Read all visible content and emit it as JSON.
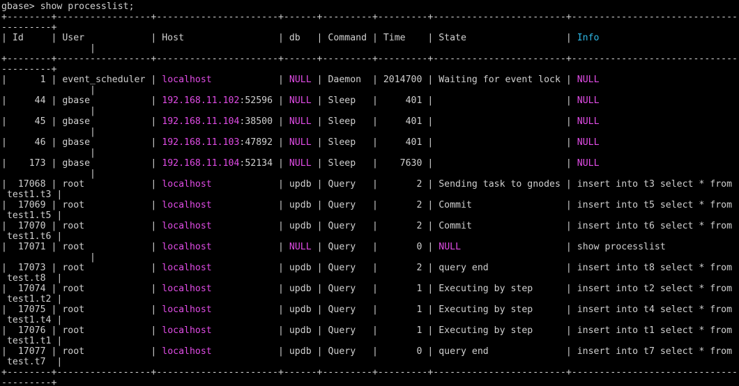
{
  "colors": {
    "background": "#000000",
    "text": "#d0d0d0",
    "null_and_host": "#e14ce6",
    "info_header": "#2fb8e6"
  },
  "terminal": {
    "lines": [
      [
        {
          "t": "gbase> show processlist;",
          "c": "default"
        }
      ],
      [
        {
          "t": "+--------+-----------------+----------------------+------+---------+---------+------------------------+------------------------------------------",
          "c": "default"
        }
      ],
      [
        {
          "t": "---------+",
          "c": "default"
        }
      ],
      [
        {
          "t": "| Id     | User            | Host                 | db   | Command | Time    | State                  | ",
          "c": "default"
        },
        {
          "t": "Info",
          "c": "cyan"
        }
      ],
      [
        {
          "t": "                |",
          "c": "default"
        }
      ],
      [
        {
          "t": "+--------+-----------------+----------------------+------+---------+---------+------------------------+------------------------------------------",
          "c": "default"
        }
      ],
      [
        {
          "t": "---------+",
          "c": "default"
        }
      ],
      [
        {
          "t": "|      1 | event_scheduler | ",
          "c": "default"
        },
        {
          "t": "localhost",
          "c": "magenta"
        },
        {
          "t": "            | ",
          "c": "default"
        },
        {
          "t": "NULL",
          "c": "magenta"
        },
        {
          "t": " | Daemon  | 2014700 | Waiting for event lock | ",
          "c": "default"
        },
        {
          "t": "NULL",
          "c": "magenta"
        }
      ],
      [
        {
          "t": "                |",
          "c": "default"
        }
      ],
      [
        {
          "t": "|     44 | gbase           | ",
          "c": "default"
        },
        {
          "t": "192.168.11.102",
          "c": "magenta"
        },
        {
          "t": ":52596 | ",
          "c": "default"
        },
        {
          "t": "NULL",
          "c": "magenta"
        },
        {
          "t": " | Sleep   |     401 |                        | ",
          "c": "default"
        },
        {
          "t": "NULL",
          "c": "magenta"
        }
      ],
      [
        {
          "t": "                |",
          "c": "default"
        }
      ],
      [
        {
          "t": "|     45 | gbase           | ",
          "c": "default"
        },
        {
          "t": "192.168.11.104",
          "c": "magenta"
        },
        {
          "t": ":38500 | ",
          "c": "default"
        },
        {
          "t": "NULL",
          "c": "magenta"
        },
        {
          "t": " | Sleep   |     401 |                        | ",
          "c": "default"
        },
        {
          "t": "NULL",
          "c": "magenta"
        }
      ],
      [
        {
          "t": "                |",
          "c": "default"
        }
      ],
      [
        {
          "t": "|     46 | gbase           | ",
          "c": "default"
        },
        {
          "t": "192.168.11.103",
          "c": "magenta"
        },
        {
          "t": ":47892 | ",
          "c": "default"
        },
        {
          "t": "NULL",
          "c": "magenta"
        },
        {
          "t": " | Sleep   |     401 |                        | ",
          "c": "default"
        },
        {
          "t": "NULL",
          "c": "magenta"
        }
      ],
      [
        {
          "t": "                |",
          "c": "default"
        }
      ],
      [
        {
          "t": "|    173 | gbase           | ",
          "c": "default"
        },
        {
          "t": "192.168.11.104",
          "c": "magenta"
        },
        {
          "t": ":52134 | ",
          "c": "default"
        },
        {
          "t": "NULL",
          "c": "magenta"
        },
        {
          "t": " | Sleep   |    7630 |                        | ",
          "c": "default"
        },
        {
          "t": "NULL",
          "c": "magenta"
        }
      ],
      [
        {
          "t": "                |",
          "c": "default"
        }
      ],
      [
        {
          "t": "|  17068 | root            | ",
          "c": "default"
        },
        {
          "t": "localhost",
          "c": "magenta"
        },
        {
          "t": "            | updb | Query   |       2 | Sending task to gnodes | insert into t3 select * from",
          "c": "default"
        }
      ],
      [
        {
          "t": " test1.t3 |",
          "c": "default"
        }
      ],
      [
        {
          "t": "|  17069 | root            | ",
          "c": "default"
        },
        {
          "t": "localhost",
          "c": "magenta"
        },
        {
          "t": "            | updb | Query   |       2 | Commit                 | insert into t5 select * from",
          "c": "default"
        }
      ],
      [
        {
          "t": " test1.t5 |",
          "c": "default"
        }
      ],
      [
        {
          "t": "|  17070 | root            | ",
          "c": "default"
        },
        {
          "t": "localhost",
          "c": "magenta"
        },
        {
          "t": "            | updb | Query   |       2 | Commit                 | insert into t6 select * from",
          "c": "default"
        }
      ],
      [
        {
          "t": " test1.t6 |",
          "c": "default"
        }
      ],
      [
        {
          "t": "|  17071 | root            | ",
          "c": "default"
        },
        {
          "t": "localhost",
          "c": "magenta"
        },
        {
          "t": "            | ",
          "c": "default"
        },
        {
          "t": "NULL",
          "c": "magenta"
        },
        {
          "t": " | Query   |       0 | ",
          "c": "default"
        },
        {
          "t": "NULL",
          "c": "magenta"
        },
        {
          "t": "                   | show processlist",
          "c": "default"
        }
      ],
      [
        {
          "t": "                |",
          "c": "default"
        }
      ],
      [
        {
          "t": "|  17073 | root            | ",
          "c": "default"
        },
        {
          "t": "localhost",
          "c": "magenta"
        },
        {
          "t": "            | updb | Query   |       2 | query end              | insert into t8 select * from",
          "c": "default"
        }
      ],
      [
        {
          "t": " test.t8  |",
          "c": "default"
        }
      ],
      [
        {
          "t": "|  17074 | root            | ",
          "c": "default"
        },
        {
          "t": "localhost",
          "c": "magenta"
        },
        {
          "t": "            | updb | Query   |       1 | Executing by step      | insert into t2 select * from",
          "c": "default"
        }
      ],
      [
        {
          "t": " test1.t2 |",
          "c": "default"
        }
      ],
      [
        {
          "t": "|  17075 | root            | ",
          "c": "default"
        },
        {
          "t": "localhost",
          "c": "magenta"
        },
        {
          "t": "            | updb | Query   |       1 | Executing by step      | insert into t4 select * from",
          "c": "default"
        }
      ],
      [
        {
          "t": " test1.t4 |",
          "c": "default"
        }
      ],
      [
        {
          "t": "|  17076 | root            | ",
          "c": "default"
        },
        {
          "t": "localhost",
          "c": "magenta"
        },
        {
          "t": "            | updb | Query   |       1 | Executing by step      | insert into t1 select * from",
          "c": "default"
        }
      ],
      [
        {
          "t": " test1.t1 |",
          "c": "default"
        }
      ],
      [
        {
          "t": "|  17077 | root            | ",
          "c": "default"
        },
        {
          "t": "localhost",
          "c": "magenta"
        },
        {
          "t": "            | updb | Query   |       0 | query end              | insert into t7 select * from",
          "c": "default"
        }
      ],
      [
        {
          "t": " test.t7  |",
          "c": "default"
        }
      ],
      [
        {
          "t": "+--------+-----------------+----------------------+------+---------+---------+------------------------+------------------------------------------",
          "c": "default"
        }
      ],
      [
        {
          "t": "---------+",
          "c": "default"
        }
      ]
    ]
  }
}
